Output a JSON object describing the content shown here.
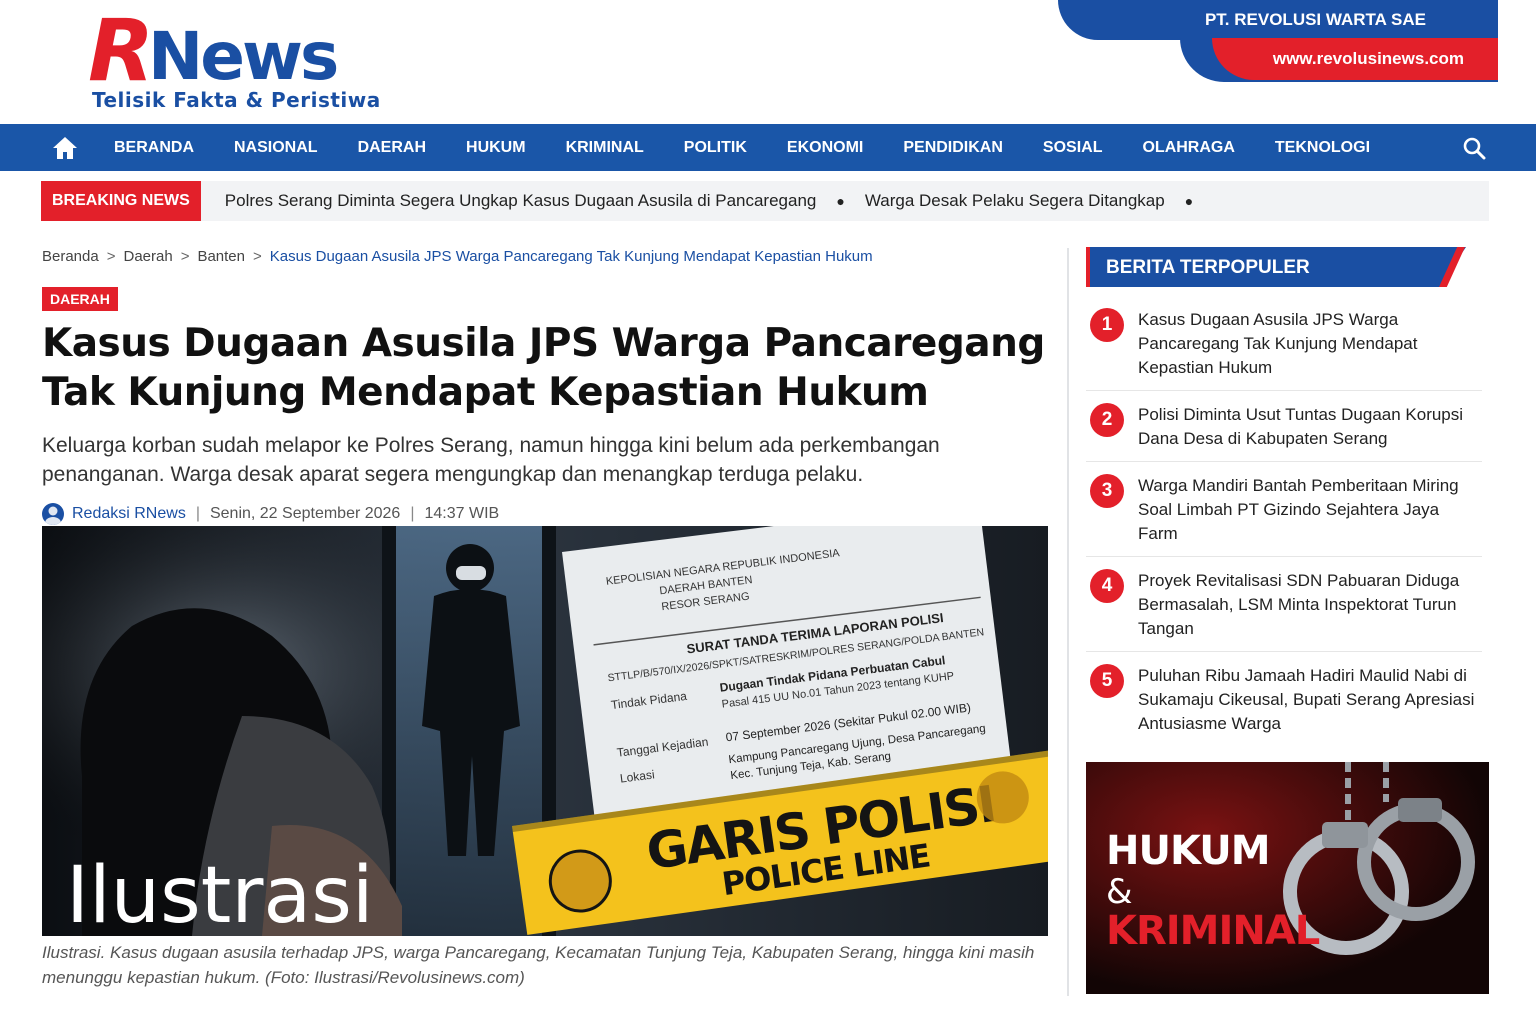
{
  "brand": {
    "logo_r": "R",
    "logo_news": "News",
    "tagline": "Telisik Fakta & Peristiwa",
    "company": "PT. REVOLUSI WARTA SAE",
    "website": "www.revolusinews.com"
  },
  "nav": {
    "items": [
      "BERANDA",
      "NASIONAL",
      "DAERAH",
      "HUKUM",
      "KRIMINAL",
      "POLITIK",
      "EKONOMI",
      "PENDIDIKAN",
      "SOSIAL",
      "OLAHRAGA",
      "TEKNOLOGI"
    ]
  },
  "ticker": {
    "label": "BREAKING NEWS",
    "items": [
      "Polres Serang Diminta Segera Ungkap Kasus Dugaan Asusila di Pancaregang",
      "Warga Desak Pelaku Segera Ditangkap"
    ]
  },
  "breadcrumb": [
    "Beranda",
    "Daerah",
    "Banten",
    "Kasus Dugaan Asusila JPS Warga Pancaregang Tak Kunjung Mendapat Kepastian Hukum"
  ],
  "article": {
    "category": "DAERAH",
    "title": "Kasus Dugaan Asusila JPS Warga Pancaregang Tak Kunjung Mendapat Kepastian Hukum",
    "lead": "Keluarga korban sudah melapor ke Polres Serang, namun hingga kini belum ada perkembangan penanganan. Warga desak aparat segera mengungkap dan menangkap terduga pelaku.",
    "author": "Redaksi RNews",
    "date": "Senin, 22 September 2026",
    "time": "14:37 WIB",
    "caption": "Ilustrasi. Kasus dugaan asusila terhadap JPS, warga Pancaregang, Kecamatan Tunjung Teja, Kabupaten Serang, hingga kini masih menunggu kepastian hukum. (Foto: Ilustrasi/Revolusinews.com)"
  },
  "hero": {
    "watermark": "Ilustrasi",
    "doc_header": [
      "KEPOLISIAN NEGARA REPUBLIK INDONESIA",
      "DAERAH BANTEN",
      "RESOR SERANG"
    ],
    "doc_title": "SURAT TANDA TERIMA LAPORAN POLISI",
    "doc_number": "STTLP/B/570/IX/2026/SPKT/SATRESKRIM/POLRES SERANG/POLDA BANTEN",
    "doc_label_tindak": "Tindak Pidana",
    "doc_value_tindak": "Dugaan Tindak Pidana Perbuatan Cabul",
    "doc_value_pasal": "Pasal 415 UU No.01 Tahun 2023 tentang KUHP",
    "doc_label_tanggal": "Tanggal Kejadian",
    "doc_value_tanggal": "07 September 2026 (Sekitar Pukul 02.00 WIB)",
    "doc_label_lokasi": "Lokasi",
    "doc_value_lokasi1": "Kampung Pancaregang Ujung, Desa Pancaregang",
    "doc_value_lokasi2": "Kec. Tunjung Teja, Kab. Serang",
    "tape_main": "GARIS POLISI",
    "tape_sub": "POLICE LINE"
  },
  "sidebar": {
    "heading": "BERITA TERPOPULER",
    "items": [
      {
        "num": "1",
        "text": "Kasus Dugaan Asusila JPS Warga Pancaregang Tak Kunjung Mendapat Kepastian Hukum"
      },
      {
        "num": "2",
        "text": "Polisi Diminta Usut Tuntas Dugaan Korupsi Dana Desa di Kabupaten Serang"
      },
      {
        "num": "3",
        "text": "Warga Mandiri Bantah Pemberitaan Miring Soal Limbah PT Gizindo Sejahtera Jaya Farm"
      },
      {
        "num": "4",
        "text": "Proyek Revitalisasi SDN Pabuaran Diduga Bermasalah, LSM Minta Inspektorat Turun Tangan"
      },
      {
        "num": "5",
        "text": "Puluhan Ribu Jamaah Hadiri Maulid Nabi di Sukamaju Cikeusal, Bupati Serang Apresiasi Antusiasme Warga"
      }
    ],
    "promo_line1": "HUKUM",
    "promo_amp": "&",
    "promo_line2": "KRIMINAL"
  },
  "colors": {
    "brand_blue": "#1a4fa3",
    "nav_blue": "#1a56a8",
    "brand_red": "#e3202a"
  },
  "icons": {
    "home": "home-icon",
    "search": "search-icon",
    "avatar": "avatar-icon",
    "handcuffs": "handcuffs-icon"
  }
}
